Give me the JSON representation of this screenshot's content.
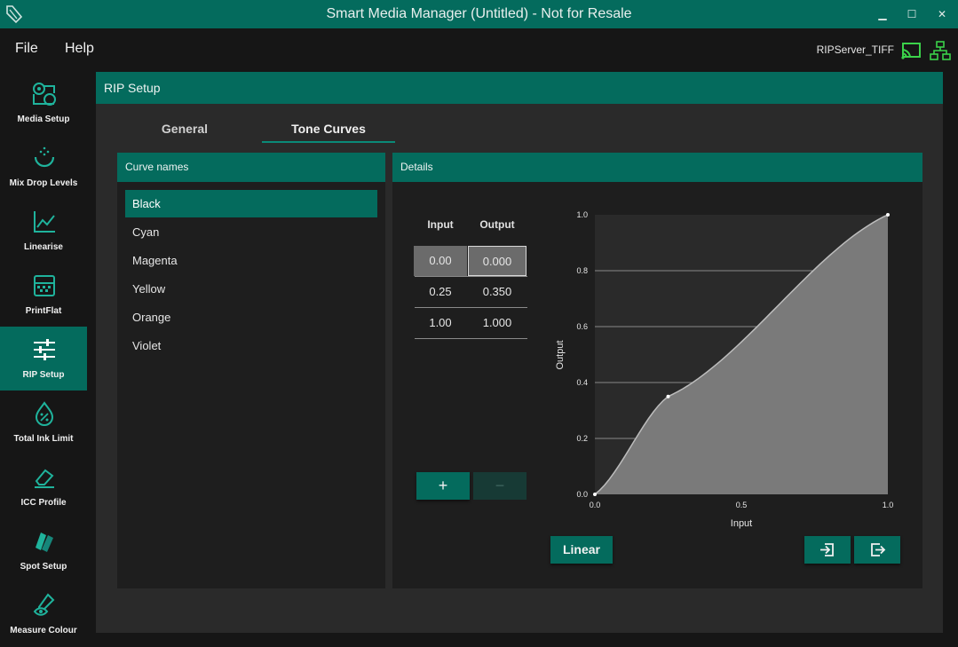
{
  "window": {
    "title": "Smart Media Manager (Untitled) - Not for Resale",
    "minimize_glyph": "▁",
    "maximize_glyph": "☐",
    "close_glyph": "✕"
  },
  "menu": {
    "file": "File",
    "help": "Help"
  },
  "server": {
    "name": "RIPServer_TIFF",
    "cast_icon": "cast-icon",
    "network_icon": "network-icon"
  },
  "sidebar": {
    "items": [
      {
        "label": "Media Setup",
        "icon": "media-rolls-icon"
      },
      {
        "label": "Mix Drop Levels",
        "icon": "drop-levels-icon"
      },
      {
        "label": "Linearise",
        "icon": "line-graph-icon"
      },
      {
        "label": "PrintFlat",
        "icon": "printflat-icon"
      },
      {
        "label": "RIP Setup",
        "icon": "sliders-icon",
        "active": true
      },
      {
        "label": "Total Ink Limit",
        "icon": "ink-drop-percent-icon"
      },
      {
        "label": "ICC Profile",
        "icon": "eraser-icon"
      },
      {
        "label": "Spot Setup",
        "icon": "swatch-icon"
      },
      {
        "label": "Measure Colour",
        "icon": "eye-dropper-icon"
      }
    ]
  },
  "panel": {
    "title": "RIP Setup",
    "tabs": [
      {
        "label": "General",
        "active": false
      },
      {
        "label": "Tone Curves",
        "active": true
      }
    ]
  },
  "curve_names": {
    "header": "Curve names",
    "items": [
      "Black",
      "Cyan",
      "Magenta",
      "Yellow",
      "Orange",
      "Violet"
    ],
    "selected": "Black"
  },
  "details": {
    "header": "Details",
    "table": {
      "columns": [
        "Input",
        "Output"
      ],
      "rows": [
        {
          "input": "0.00",
          "output": "0.000"
        },
        {
          "input": "0.25",
          "output": "0.350"
        },
        {
          "input": "1.00",
          "output": "1.000"
        }
      ]
    },
    "add_label": "+",
    "remove_label": "−",
    "linear_label": "Linear",
    "import_icon": "import-icon",
    "export_icon": "export-icon"
  },
  "chart_data": {
    "type": "area",
    "xlabel": "Input",
    "ylabel": "Output",
    "xlim": [
      0,
      1
    ],
    "ylim": [
      0,
      1
    ],
    "x_ticks": [
      "0.0",
      "0.5",
      "1.0"
    ],
    "y_ticks": [
      "0.0",
      "0.2",
      "0.4",
      "0.6",
      "0.8",
      "1.0"
    ],
    "grid": "horizontal",
    "series": [
      {
        "x": [
          0.0,
          0.25,
          1.0
        ],
        "values": [
          0.0,
          0.35,
          1.0
        ]
      }
    ],
    "colors": {
      "fill": "#7a7a7a",
      "line": "#bdbdbd",
      "grid": "#a8a8a8",
      "background": "#2a2a2a"
    }
  },
  "colors": {
    "accent": "#046b5d",
    "background": "#161616",
    "panel": "#2a2a2a",
    "subpanel": "#1e1e1e"
  }
}
